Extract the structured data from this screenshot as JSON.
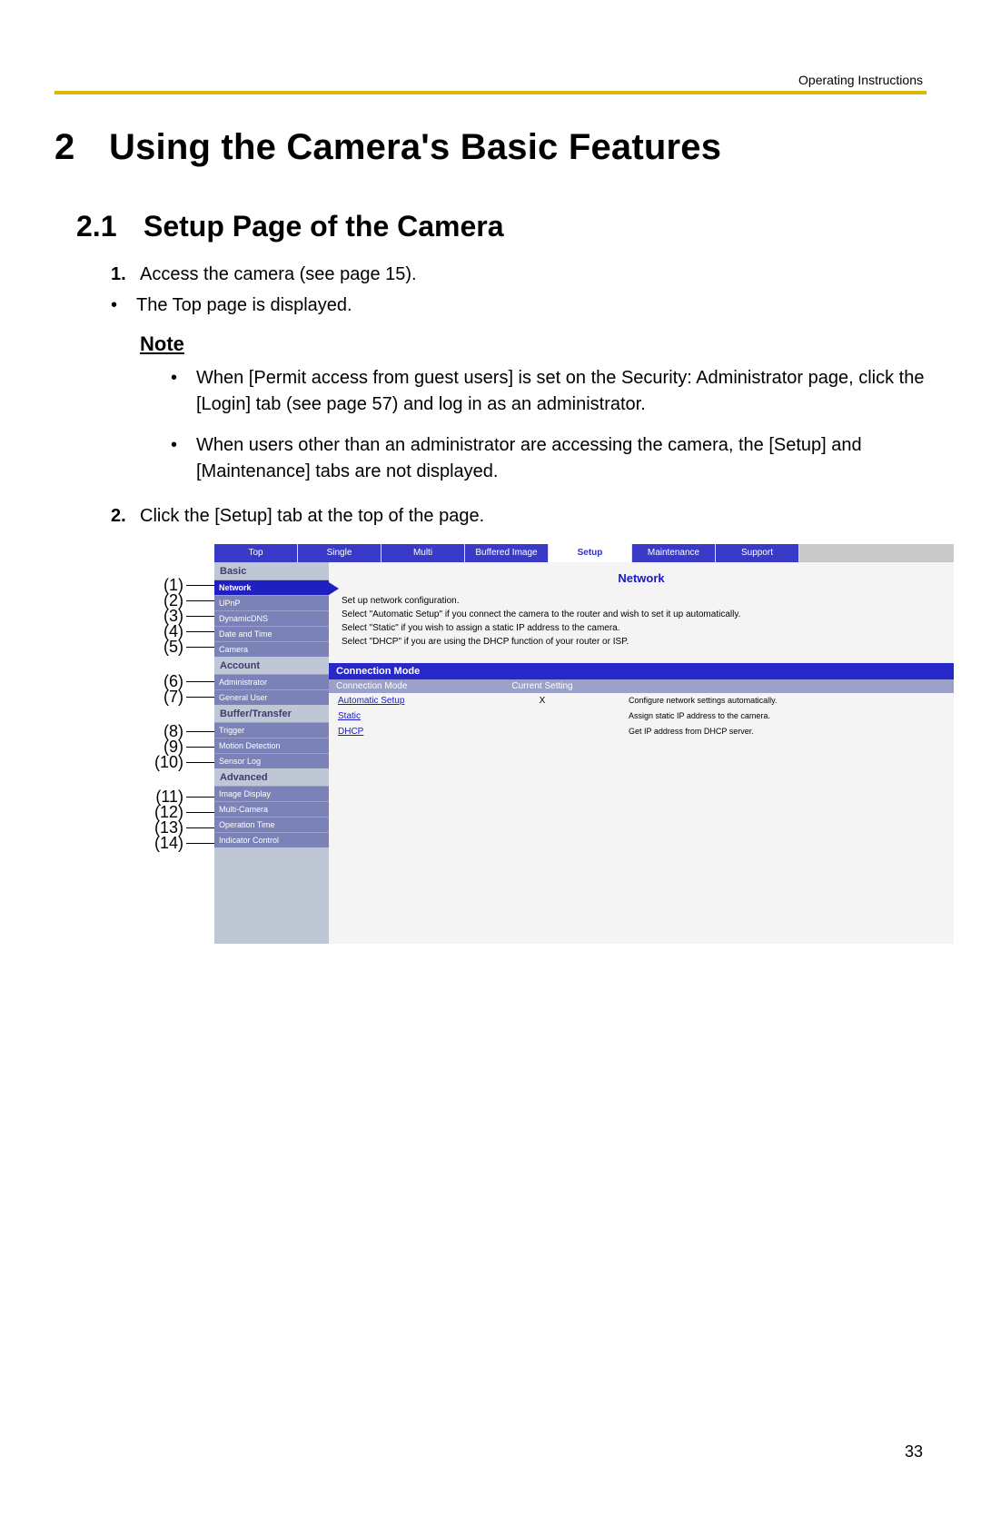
{
  "header_text": "Operating Instructions",
  "h1_num": "2",
  "h1_title": "Using the Camera's Basic Features",
  "h2_num": "2.1",
  "h2_title": "Setup Page of the Camera",
  "step1_num": "1.",
  "step1_text": "Access the camera (see page 15).",
  "step1_bullet": "The Top page is displayed.",
  "note_label": "Note",
  "note_bullet1": "When [Permit access from guest users] is set on the Security: Administrator page, click the [Login] tab (see page 57) and log in as an administrator.",
  "note_bullet2": "When users other than an administrator are accessing the camera, the [Setup] and [Maintenance] tabs are not displayed.",
  "step2_num": "2.",
  "step2_text": "Click the [Setup] tab at the top of the page.",
  "callouts": {
    "c1": "(1)",
    "c2": "(2)",
    "c3": "(3)",
    "c4": "(4)",
    "c5": "(5)",
    "c6": "(6)",
    "c7": "(7)",
    "c8": "(8)",
    "c9": "(9)",
    "c10": "(10)",
    "c11": "(11)",
    "c12": "(12)",
    "c13": "(13)",
    "c14": "(14)"
  },
  "tabs": {
    "t1": "Top",
    "t2": "Single",
    "t3": "Multi",
    "t4": "Buffered Image",
    "t5": "Setup",
    "t6": "Maintenance",
    "t7": "Support"
  },
  "sidebar": {
    "g1": "Basic",
    "i1": "Network",
    "i2": "UPnP",
    "i3": "DynamicDNS",
    "i4": "Date and Time",
    "i5": "Camera",
    "g2": "Account",
    "i6": "Administrator",
    "i7": "General User",
    "g3": "Buffer/Transfer",
    "i8": "Trigger",
    "i9": "Motion Detection",
    "i10": "Sensor Log",
    "g4": "Advanced",
    "i11": "Image Display",
    "i12": "Multi-Camera",
    "i13": "Operation Time",
    "i14": "Indicator Control"
  },
  "panel": {
    "title": "Network",
    "desc1": "Set up network configuration.",
    "desc2": "Select \"Automatic Setup\" if you connect the camera to the router and wish to set it up automatically.",
    "desc3": "Select \"Static\" if you wish to assign a static IP address to the camera.",
    "desc4": "Select \"DHCP\" if you are using the DHCP function of your router or ISP.",
    "section_hdr": "Connection Mode",
    "th_mode": "Connection Mode",
    "th_cur": "Current Setting",
    "r1_mode": "Automatic Setup",
    "r1_cur": "X",
    "r1_hint": "Configure network settings automatically.",
    "r2_mode": "Static",
    "r2_cur": "",
    "r2_hint": "Assign static IP address to the camera.",
    "r3_mode": "DHCP",
    "r3_cur": "",
    "r3_hint": "Get IP address from DHCP server."
  },
  "page_number": "33"
}
